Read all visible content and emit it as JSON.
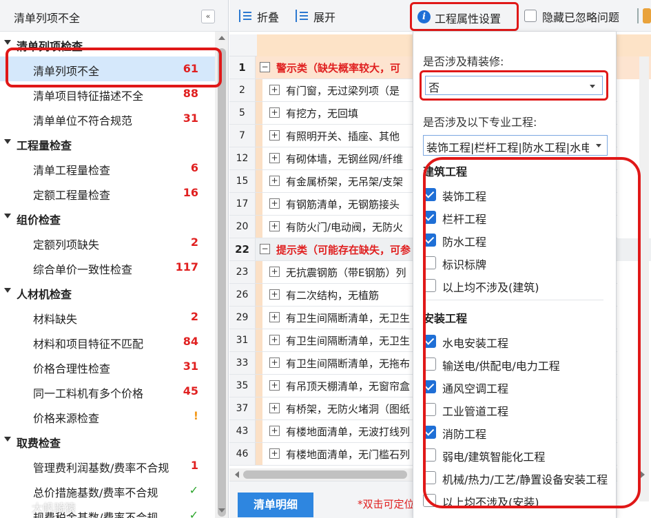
{
  "left": {
    "title": "清单列项不全",
    "collapse_icon": "«",
    "groups": [
      {
        "label": "清单列项检查",
        "items": [
          {
            "label": "清单列项不全",
            "count": "61",
            "color": "#e02020"
          },
          {
            "label": "清单项目特征描述不全",
            "count": "88",
            "color": "#e02020"
          },
          {
            "label": "清单单位不符合规范",
            "count": "31",
            "color": "#e02020"
          }
        ]
      },
      {
        "label": "工程量检查",
        "items": [
          {
            "label": "清单工程量检查",
            "count": "6",
            "color": "#e02020"
          },
          {
            "label": "定额工程量检查",
            "count": "16",
            "color": "#e02020"
          }
        ]
      },
      {
        "label": "组价检查",
        "items": [
          {
            "label": "定额列项缺失",
            "count": "2",
            "color": "#e02020"
          },
          {
            "label": "综合单价一致性检查",
            "count": "117",
            "color": "#e02020"
          }
        ]
      },
      {
        "label": "人材机检查",
        "items": [
          {
            "label": "材料缺失",
            "count": "2",
            "color": "#e02020"
          },
          {
            "label": "材料和项目特征不匹配",
            "count": "84",
            "color": "#e02020"
          },
          {
            "label": "价格合理性检查",
            "count": "31",
            "color": "#e02020"
          },
          {
            "label": "同一工料机有多个价格",
            "count": "45",
            "color": "#e02020"
          },
          {
            "label": "价格来源检查",
            "count": "!",
            "color": "#f39a1d"
          }
        ]
      },
      {
        "label": "取费检查",
        "items": [
          {
            "label": "管理费利润基数/费率不合规",
            "count": "1",
            "color": "#e02020"
          },
          {
            "label": "总价措施基数/费率不合规",
            "count": "✓",
            "color": "#2aa52a"
          },
          {
            "label": "规费税金基数/费率不合规",
            "count": "✓",
            "color": "#2aa52a"
          }
        ]
      }
    ]
  },
  "toolbar": {
    "fold_label": "折叠",
    "unfold_label": "展开",
    "attr_label": "工程属性设置",
    "info_icon": "i",
    "hide_label": "隐藏已忽略问题"
  },
  "table": {
    "rows": [
      {
        "num": "1",
        "text": "警示类（缺失概率较大，可",
        "kind": "warn",
        "toggle": "−"
      },
      {
        "num": "2",
        "text": "有门窗，无过梁列项（是",
        "kind": "item",
        "toggle": "+"
      },
      {
        "num": "5",
        "text": "有挖方，无回填",
        "kind": "item",
        "toggle": "+"
      },
      {
        "num": "7",
        "text": "有照明开关、插座、其他",
        "kind": "item",
        "toggle": "+"
      },
      {
        "num": "12",
        "text": "有砌体墙，无钢丝网/纤维",
        "kind": "item",
        "toggle": "+"
      },
      {
        "num": "15",
        "text": "有金属桥架，无吊架/支架",
        "kind": "item",
        "toggle": "+"
      },
      {
        "num": "17",
        "text": "有钢筋清单，无钢筋接头",
        "kind": "item",
        "toggle": "+"
      },
      {
        "num": "20",
        "text": "有防火门/电动阀，无防火",
        "kind": "item",
        "toggle": "+"
      },
      {
        "num": "22",
        "text": "提示类（可能存在缺失，可参",
        "kind": "hint",
        "toggle": "−"
      },
      {
        "num": "23",
        "text": "无抗震钢筋（带E钢筋）列",
        "kind": "item",
        "toggle": "+"
      },
      {
        "num": "26",
        "text": "有二次结构，无植筋",
        "kind": "item",
        "toggle": "+"
      },
      {
        "num": "29",
        "text": "有卫生间隔断清单，无卫生",
        "kind": "item",
        "toggle": "+"
      },
      {
        "num": "31",
        "text": "有卫生间隔断清单，无卫生",
        "kind": "item",
        "toggle": "+"
      },
      {
        "num": "33",
        "text": "有卫生间隔断清单，无拖布",
        "kind": "item",
        "toggle": "+"
      },
      {
        "num": "35",
        "text": "有吊顶天棚清单，无窗帘盒",
        "kind": "item",
        "toggle": "+"
      },
      {
        "num": "37",
        "text": "有桥架，无防火堵洞（图纸",
        "kind": "item",
        "toggle": "+"
      },
      {
        "num": "43",
        "text": "有楼地面清单，无波打线列",
        "kind": "item",
        "toggle": "+"
      },
      {
        "num": "46",
        "text": "有楼地面清单，无门槛石列",
        "kind": "item",
        "toggle": "+"
      }
    ]
  },
  "bottom": {
    "detail_label": "清单明细",
    "hint": "*双击可定位"
  },
  "panel": {
    "q1": "是否涉及精装修:",
    "q1_value": "否",
    "q2": "是否涉及以下专业工程:",
    "q2_value": "装饰工程|栏杆工程|防水工程|水电",
    "sections": [
      {
        "title": "建筑工程",
        "options": [
          {
            "label": "装饰工程",
            "checked": true
          },
          {
            "label": "栏杆工程",
            "checked": true
          },
          {
            "label": "防水工程",
            "checked": true
          },
          {
            "label": "标识标牌",
            "checked": false
          },
          {
            "label": "以上均不涉及(建筑)",
            "checked": false
          }
        ]
      },
      {
        "title": "安装工程",
        "options": [
          {
            "label": "水电安装工程",
            "checked": true
          },
          {
            "label": "输送电/供配电/电力工程",
            "checked": false
          },
          {
            "label": "通风空调工程",
            "checked": true
          },
          {
            "label": "工业管道工程",
            "checked": false
          },
          {
            "label": "消防工程",
            "checked": true
          },
          {
            "label": "弱电/建筑智能化工程",
            "checked": false
          },
          {
            "label": "机械/热力/工艺/静置设备安装工程",
            "checked": false
          },
          {
            "label": "以上均不涉及(安装)",
            "checked": false
          }
        ]
      }
    ]
  },
  "watermark": {
    "text": "大帆骑猿"
  },
  "colors": {
    "accent": "#1f6fd6",
    "highlight_red": "#e01818",
    "count_red": "#e02020",
    "selected_row": "#d5e8fb",
    "warn_row": "#fde4d0"
  }
}
